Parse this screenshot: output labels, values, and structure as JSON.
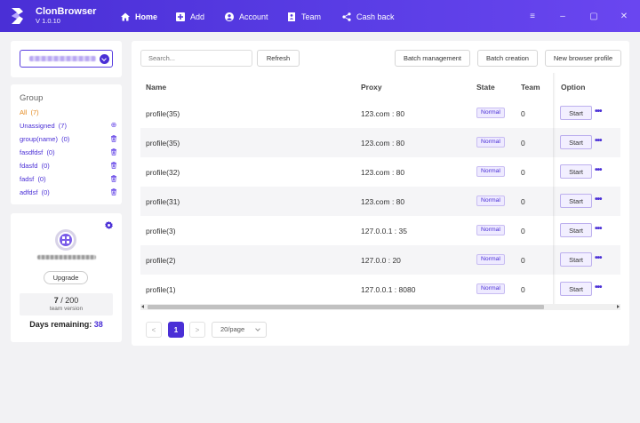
{
  "app": {
    "name": "ClonBrowser",
    "version": "V 1.0.10"
  },
  "nav": {
    "home": "Home",
    "add": "Add",
    "account": "Account",
    "team": "Team",
    "cash_back": "Cash back"
  },
  "groups": {
    "title": "Group",
    "items": [
      {
        "name": "All",
        "count": "(7)",
        "icon": ""
      },
      {
        "name": "Unassigned",
        "count": "(7)",
        "icon": "add-circle-icon"
      },
      {
        "name": "group(name)",
        "count": "(0)",
        "icon": "trash-icon"
      },
      {
        "name": "fasdfdsf",
        "count": "(0)",
        "icon": "trash-icon"
      },
      {
        "name": "fdasfd",
        "count": "(0)",
        "icon": "trash-icon"
      },
      {
        "name": "fadsf",
        "count": "(0)",
        "icon": "trash-icon"
      },
      {
        "name": "adfdsf",
        "count": "(0)",
        "icon": "trash-icon"
      }
    ]
  },
  "account": {
    "upgrade_label": "Upgrade",
    "used": "7",
    "separator": " / ",
    "limit": "200",
    "plan": "team version",
    "days_label": "Days remaining:",
    "days_value": "38"
  },
  "toolbar": {
    "search_placeholder": "Search...",
    "refresh": "Refresh",
    "batch_management": "Batch management",
    "batch_creation": "Batch creation",
    "new_profile": "New browser profile"
  },
  "table": {
    "columns": [
      "Name",
      "Proxy",
      "State",
      "Team",
      "Option"
    ],
    "rows": [
      {
        "name": "profile(35)",
        "proxy": "123.com : 80",
        "state": "Normal",
        "team": "0",
        "action": "Start"
      },
      {
        "name": "profile(35)",
        "proxy": "123.com : 80",
        "state": "Normal",
        "team": "0",
        "action": "Start"
      },
      {
        "name": "profile(32)",
        "proxy": "123.com : 80",
        "state": "Normal",
        "team": "0",
        "action": "Start"
      },
      {
        "name": "profile(31)",
        "proxy": "123.com : 80",
        "state": "Normal",
        "team": "0",
        "action": "Start"
      },
      {
        "name": "profile(3)",
        "proxy": "127.0.0.1 : 35",
        "state": "Normal",
        "team": "0",
        "action": "Start"
      },
      {
        "name": "profile(2)",
        "proxy": "127.0.0 : 20",
        "state": "Normal",
        "team": "0",
        "action": "Start"
      },
      {
        "name": "profile(1)",
        "proxy": "127.0.0.1 : 8080",
        "state": "Normal",
        "team": "0",
        "action": "Start"
      }
    ]
  },
  "pagination": {
    "prev": "<",
    "current": "1",
    "next": ">",
    "page_size": "20/page"
  },
  "colors": {
    "accent": "#4a2fd6",
    "all_group": "#e48a1f"
  }
}
